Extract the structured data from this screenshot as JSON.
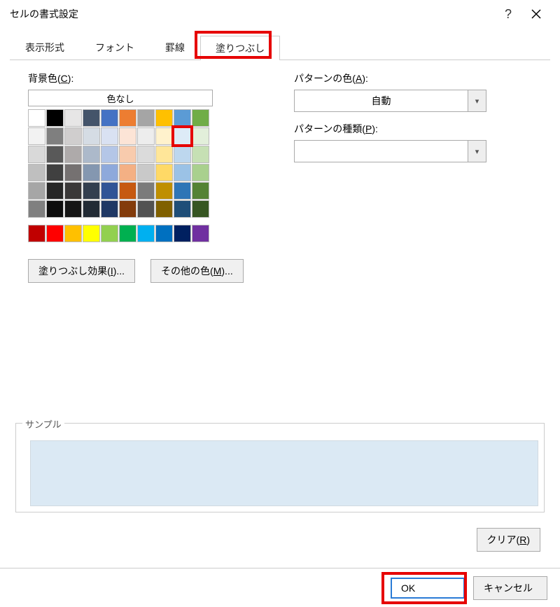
{
  "title": "セルの書式設定",
  "tabs": [
    {
      "label": "表示形式",
      "active": false
    },
    {
      "label": "フォント",
      "active": false
    },
    {
      "label": "罫線",
      "active": false
    },
    {
      "label": "塗りつぶし",
      "active": true
    }
  ],
  "bg_color_label_pre": "背景色(",
  "bg_color_label_u": "C",
  "bg_color_label_post": "):",
  "no_color": "色なし",
  "theme_colors": [
    [
      "#ffffff",
      "#000000",
      "#e7e6e6",
      "#44546a",
      "#4472c4",
      "#ed7d31",
      "#a5a5a5",
      "#ffc000",
      "#5b9bd5",
      "#70ad47"
    ],
    [
      "#f2f2f2",
      "#7f7f7f",
      "#d0cece",
      "#d5dce4",
      "#d9e1f2",
      "#fce4d6",
      "#ededed",
      "#fff2cc",
      "#ddebf7",
      "#e2efda"
    ],
    [
      "#d9d9d9",
      "#595959",
      "#aeaaaa",
      "#acb9ca",
      "#b4c6e7",
      "#f8cbad",
      "#dbdbdb",
      "#ffe699",
      "#bdd7ee",
      "#c6e0b4"
    ],
    [
      "#bfbfbf",
      "#404040",
      "#757171",
      "#8497b0",
      "#8ea9db",
      "#f4b084",
      "#c9c9c9",
      "#ffd966",
      "#9bc2e6",
      "#a9d08e"
    ],
    [
      "#a6a6a6",
      "#262626",
      "#3a3838",
      "#333f4f",
      "#305496",
      "#c65911",
      "#7b7b7b",
      "#bf8f00",
      "#2e75b6",
      "#548235"
    ],
    [
      "#808080",
      "#0d0d0d",
      "#161616",
      "#222b35",
      "#1f3864",
      "#833c0c",
      "#525252",
      "#806000",
      "#1f4e78",
      "#375623"
    ]
  ],
  "standard_colors": [
    "#c00000",
    "#ff0000",
    "#ffc000",
    "#ffff00",
    "#92d050",
    "#00b050",
    "#00b0f0",
    "#0070c0",
    "#002060",
    "#7030a0"
  ],
  "selected_swatch": {
    "row": 1,
    "col": 8
  },
  "fill_effects_pre": "塗りつぶし効果(",
  "fill_effects_u": "I",
  "fill_effects_post": ")...",
  "more_colors_pre": "その他の色(",
  "more_colors_u": "M",
  "more_colors_post": ")...",
  "pattern_color_label_pre": "パターンの色(",
  "pattern_color_label_u": "A",
  "pattern_color_label_post": "):",
  "pattern_color_value": "自動",
  "pattern_type_label_pre": "パターンの種類(",
  "pattern_type_label_u": "P",
  "pattern_type_label_post": "):",
  "pattern_type_value": "",
  "sample_label": "サンプル",
  "sample_color": "#dbe9f4",
  "clear_pre": "クリア(",
  "clear_u": "R",
  "clear_post": ")",
  "ok_label": "OK",
  "cancel_label": "キャンセル"
}
